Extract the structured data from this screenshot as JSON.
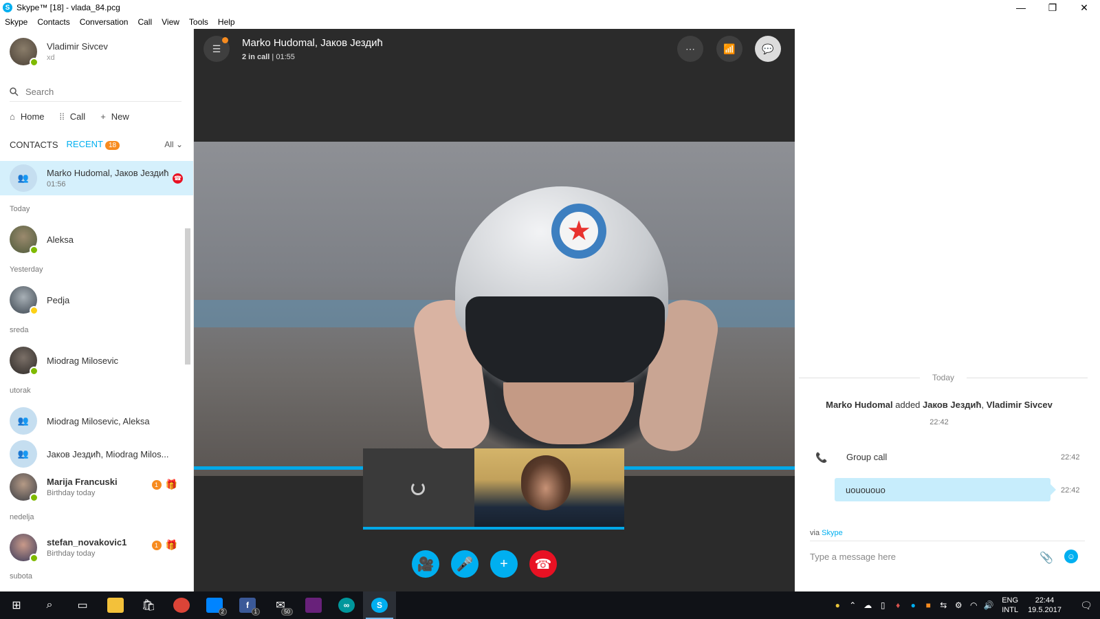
{
  "window": {
    "title": "Skype™ [18] - vlada_84.pcg",
    "logo_letter": "S",
    "minimize_glyph": "—",
    "restore_glyph": "❐",
    "close_glyph": "✕"
  },
  "menu": [
    "Skype",
    "Contacts",
    "Conversation",
    "Call",
    "View",
    "Tools",
    "Help"
  ],
  "profile": {
    "name": "Vladimir Sivcev",
    "mood": "xd"
  },
  "search": {
    "placeholder": "Search"
  },
  "nav": {
    "home": "Home",
    "call": "Call",
    "new": "New"
  },
  "tabs": {
    "contacts": "CONTACTS",
    "recent": "RECENT",
    "recent_badge": "18",
    "filter": "All"
  },
  "active_conversation": {
    "name": "Marko Hudomal, Јаков Јездић",
    "time": "01:56"
  },
  "sections": {
    "today": "Today",
    "yesterday": "Yesterday",
    "sreda": "sreda",
    "utorak": "utorak",
    "nedelja": "nedelja",
    "subota": "subota"
  },
  "contacts": {
    "aleksa": {
      "name": "Aleksa"
    },
    "pedja": {
      "name": "Pedja"
    },
    "miodrag": {
      "name": "Miodrag Milosevic"
    },
    "group1": {
      "name": "Miodrag Milosevic, Aleksa"
    },
    "group2": {
      "name": "Јаков Јездић, Miodrag Milos..."
    },
    "marija": {
      "name": "Marija Francuski",
      "sub": "Birthday today",
      "badge": "1"
    },
    "stefan": {
      "name": "stefan_novakovic1",
      "sub": "Birthday today",
      "badge": "1"
    }
  },
  "call": {
    "title": "Marko Hudomal, Јаков Јездић",
    "status_count": "2 in call",
    "status_time": "01:55"
  },
  "chat": {
    "day": "Today",
    "sys_actor": "Marko Hudomal",
    "sys_verb": "added",
    "sys_target1": "Јаков Јездић",
    "sys_target2": "Vladimir Sivcev",
    "sys_time": "22:42",
    "group_call_label": "Group call",
    "group_call_time": "22:42",
    "message": "uouououo",
    "message_time": "22:42",
    "via_label": "via",
    "via_link": "Skype",
    "composer_placeholder": "Type a message here"
  },
  "taskbar": {
    "messenger_count": "2",
    "facebook_count": "1",
    "app_count": "50",
    "lang_line1": "ENG",
    "lang_line2": "INTL",
    "time": "22:44",
    "date": "19.5.2017"
  },
  "colors": {
    "skype_blue": "#00aff0",
    "end_call_red": "#e81123",
    "badge_orange": "#f78b1f",
    "active_row": "#d5f0fc",
    "online_green": "#7fba00"
  }
}
